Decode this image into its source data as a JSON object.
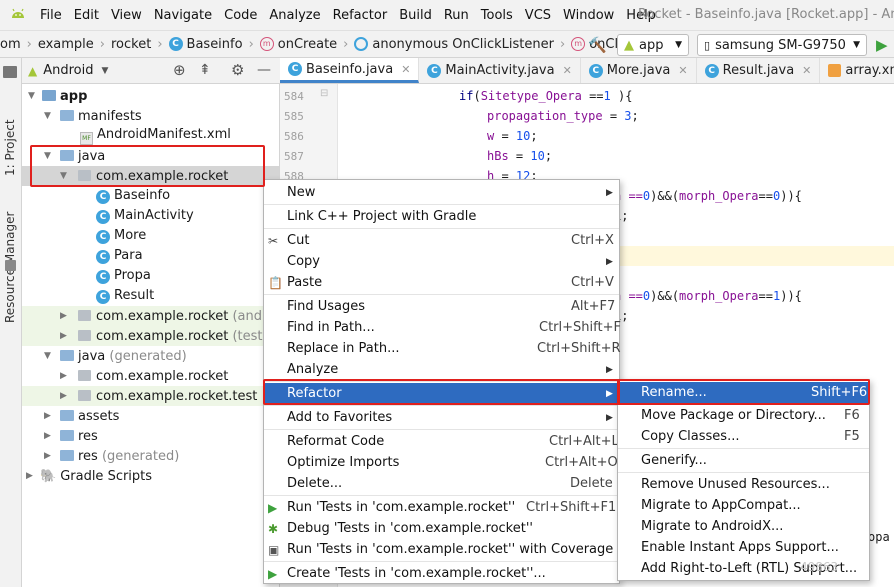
{
  "menubar": {
    "items": [
      "File",
      "Edit",
      "View",
      "Navigate",
      "Code",
      "Analyze",
      "Refactor",
      "Build",
      "Run",
      "Tools",
      "VCS",
      "Window",
      "Help"
    ],
    "window_title": "Rocket - Baseinfo.java [Rocket.app] - Andro"
  },
  "navbar": {
    "crumbs": [
      "om",
      "example",
      "rocket",
      "Baseinfo",
      "onCreate",
      "anonymous OnClickListener",
      "onClick"
    ],
    "config": "app",
    "device": "samsung SM-G9750"
  },
  "leftstrip": {
    "project_tab": "1: Project",
    "resource_tab": "Resource Manager"
  },
  "project": {
    "view": "Android",
    "tree": [
      {
        "label": "app",
        "kind": "module"
      },
      {
        "label": "manifests",
        "kind": "folder"
      },
      {
        "label": "AndroidManifest.xml",
        "kind": "manifest"
      },
      {
        "label": "java",
        "kind": "folder"
      },
      {
        "label": "com.example.rocket",
        "kind": "package"
      },
      {
        "label": "Baseinfo",
        "kind": "class"
      },
      {
        "label": "MainActivity",
        "kind": "class"
      },
      {
        "label": "More",
        "kind": "class"
      },
      {
        "label": "Para",
        "kind": "class"
      },
      {
        "label": "Propa",
        "kind": "class"
      },
      {
        "label": "Result",
        "kind": "class"
      },
      {
        "label": "com.example.rocket",
        "suffix": "(android",
        "kind": "package"
      },
      {
        "label": "com.example.rocket",
        "suffix": "(test)",
        "kind": "package"
      },
      {
        "label": "java",
        "suffix": "(generated)",
        "kind": "folder"
      },
      {
        "label": "com.example.rocket",
        "kind": "package"
      },
      {
        "label": "com.example.rocket.test",
        "kind": "package"
      },
      {
        "label": "assets",
        "kind": "folder"
      },
      {
        "label": "res",
        "kind": "folder"
      },
      {
        "label": "res",
        "suffix": "(generated)",
        "kind": "folder"
      },
      {
        "label": "Gradle Scripts",
        "kind": "gradle"
      }
    ]
  },
  "editor": {
    "tabs": [
      "Baseinfo.java",
      "MainActivity.java",
      "More.java",
      "Result.java",
      "array.xml"
    ],
    "line_numbers": [
      "584",
      "585",
      "586",
      "587",
      "588"
    ],
    "lines": {
      "l1_kw": "if",
      "l1_a": "(",
      "l1_b": "Sitetype_Opera",
      "l1_c": " ==",
      "l1_d": "1",
      "l1_e": " ){",
      "l2_a": "propagation_type",
      "l2_b": " = ",
      "l2_c": "3",
      "l2_d": ";",
      "l3_a": "w",
      "l3_b": " = ",
      "l3_c": "10",
      "l3_d": ";",
      "l4_a": "hBs",
      "l4_b": " = ",
      "l4_c": "10",
      "l4_d": ";",
      "l5_a": "h",
      "l5_b": " = ",
      "l5_c": "12",
      "l5_d": ";",
      "l6_a": "a ==",
      "l6_b": "0",
      "l6_c": ")&&(",
      "l6_d": "morph_Opera",
      "l6_e": "==",
      "l6_f": "0",
      "l6_g": ")){",
      "l7": "1;",
      "l8_a": "a ==",
      "l8_b": "0",
      "l8_c": ")&&(",
      "l8_d": "morph_Opera",
      "l8_e": "==",
      "l8_f": "1",
      "l8_g": ")){",
      "l9": "1;",
      "l10": "opa"
    }
  },
  "context_menu": {
    "items": [
      {
        "label": "New",
        "shortcut": "",
        "submenu": true
      },
      {
        "label": "Link C++ Project with Gradle",
        "shortcut": "",
        "submenu": false
      },
      {
        "label": "Cut",
        "shortcut": "Ctrl+X",
        "submenu": false
      },
      {
        "label": "Copy",
        "shortcut": "",
        "submenu": true
      },
      {
        "label": "Paste",
        "shortcut": "Ctrl+V",
        "submenu": false
      },
      {
        "label": "Find Usages",
        "shortcut": "Alt+F7",
        "submenu": false
      },
      {
        "label": "Find in Path...",
        "shortcut": "Ctrl+Shift+F",
        "submenu": false
      },
      {
        "label": "Replace in Path...",
        "shortcut": "Ctrl+Shift+R",
        "submenu": false
      },
      {
        "label": "Analyze",
        "shortcut": "",
        "submenu": true
      },
      {
        "label": "Refactor",
        "shortcut": "",
        "submenu": true
      },
      {
        "label": "Add to Favorites",
        "shortcut": "",
        "submenu": true
      },
      {
        "label": "Reformat Code",
        "shortcut": "Ctrl+Alt+L",
        "submenu": false
      },
      {
        "label": "Optimize Imports",
        "shortcut": "Ctrl+Alt+O",
        "submenu": false
      },
      {
        "label": "Delete...",
        "shortcut": "Delete",
        "submenu": false
      },
      {
        "label": "Run 'Tests in 'com.example.rocket''",
        "shortcut": "Ctrl+Shift+F10",
        "submenu": false
      },
      {
        "label": "Debug 'Tests in 'com.example.rocket''",
        "shortcut": "",
        "submenu": false
      },
      {
        "label": "Run 'Tests in 'com.example.rocket'' with Coverage",
        "shortcut": "",
        "submenu": false
      },
      {
        "label": "Create 'Tests in 'com.example.rocket''...",
        "shortcut": "",
        "submenu": false
      }
    ]
  },
  "refactor_menu": {
    "items": [
      {
        "label": "Rename...",
        "shortcut": "Shift+F6"
      },
      {
        "label": "Move Package or Directory...",
        "shortcut": "F6"
      },
      {
        "label": "Copy Classes...",
        "shortcut": "F5"
      },
      {
        "label": "Generify...",
        "shortcut": ""
      },
      {
        "label": "Remove Unused Resources...",
        "shortcut": ""
      },
      {
        "label": "Migrate to AppCompat...",
        "shortcut": ""
      },
      {
        "label": "Migrate to AndroidX...",
        "shortcut": ""
      },
      {
        "label": "Enable Instant Apps Support...",
        "shortcut": ""
      },
      {
        "label": "Add Right-to-Left (RTL) Support...",
        "shortcut": ""
      }
    ]
  },
  "watermark": "49863",
  "colors": {
    "highlight": "#2e6bc0",
    "annotation": "#e0201d",
    "android_green": "#a4c639"
  }
}
